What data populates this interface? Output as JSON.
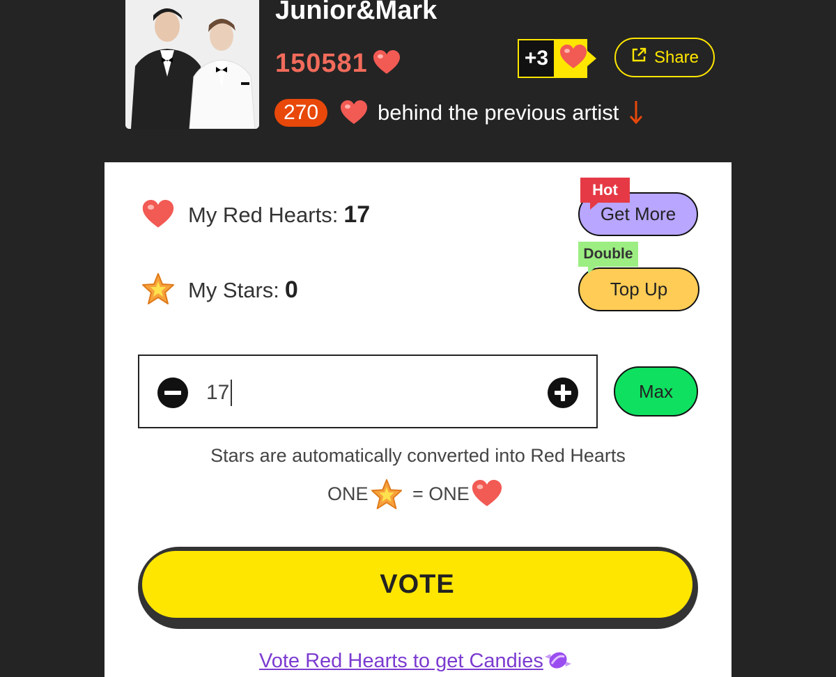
{
  "artist": {
    "name": "Junior&Mark",
    "votes": "150581",
    "bonus": "+3",
    "share_label": "Share",
    "behind_count": "270",
    "behind_text": "behind the previous artist"
  },
  "wallet": {
    "red_hearts_label": "My Red Hearts:",
    "red_hearts_value": "17",
    "stars_label": "My Stars:",
    "stars_value": "0",
    "get_more_label": "Get More",
    "hot_tag": "Hot",
    "top_up_label": "Top Up",
    "double_tag": "Double"
  },
  "stepper": {
    "value": "17",
    "max_label": "Max"
  },
  "info": {
    "line1": "Stars are automatically converted into Red Hearts",
    "one_left": "ONE",
    "one_right": "= ONE"
  },
  "vote_label": "VOTE",
  "candy_link": "Vote Red Hearts to get Candies",
  "colors": {
    "background": "#242424",
    "accent_yellow": "#ffe600",
    "vote_count": "#f26b5b",
    "behind_pill": "#e8480a",
    "get_more_bg": "#b8a6ff",
    "top_up_bg": "#ffcc55",
    "max_bg": "#10e060",
    "hot_tag": "#e53a45",
    "double_tag": "#9cee82",
    "link": "#7b3bd0"
  },
  "icons": [
    "heart-icon",
    "star-icon",
    "share-icon",
    "down-arrow-icon",
    "minus-icon",
    "plus-icon",
    "candy-icon"
  ]
}
